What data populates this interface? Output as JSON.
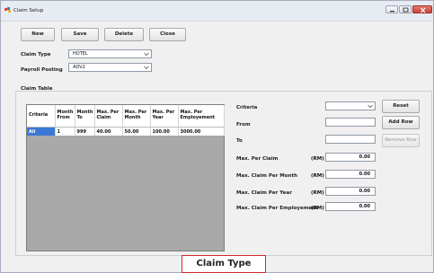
{
  "window": {
    "title": "Claim Setup"
  },
  "toolbar": {
    "new_label": "New",
    "save_label": "Save",
    "delete_label": "Delete",
    "close_label": "Close"
  },
  "form": {
    "claim_type_label": "Claim Type",
    "claim_type_value": "HOTEL",
    "payroll_posting_label": "Payroll Posting",
    "payroll_posting_value": "ADV2"
  },
  "claim_table": {
    "group_label": "Claim Table",
    "columns": [
      "Criteria",
      "Month From",
      "Month To",
      "Max. Per Claim",
      "Max. Per Month",
      "Max. Per Year",
      "Max. Per Employement"
    ],
    "rows": [
      [
        "All",
        "1",
        "999",
        "40.00",
        "50.00",
        "100.00",
        "3000.00"
      ]
    ]
  },
  "right_panel": {
    "criteria_label": "Criteria",
    "criteria_value": "",
    "from_label": "From",
    "from_value": "",
    "to_label": "To",
    "to_value": "",
    "max_per_claim_label": "Max. Per Claim",
    "max_per_claim_value": "0.00",
    "max_claim_per_month_label": "Max. Claim Per Month",
    "max_claim_per_month_value": "0.00",
    "max_claim_per_year_label": "Max. Claim Per Year",
    "max_claim_per_year_value": "0.00",
    "max_claim_per_employment_label": "Max. Claim Per Employement",
    "max_claim_per_employment_value": "0.00",
    "currency_unit": "(RM)",
    "reset_label": "Reset",
    "add_row_label": "Add Row",
    "remove_row_label": "Remove Row"
  },
  "caption": {
    "text": "Claim Type"
  }
}
